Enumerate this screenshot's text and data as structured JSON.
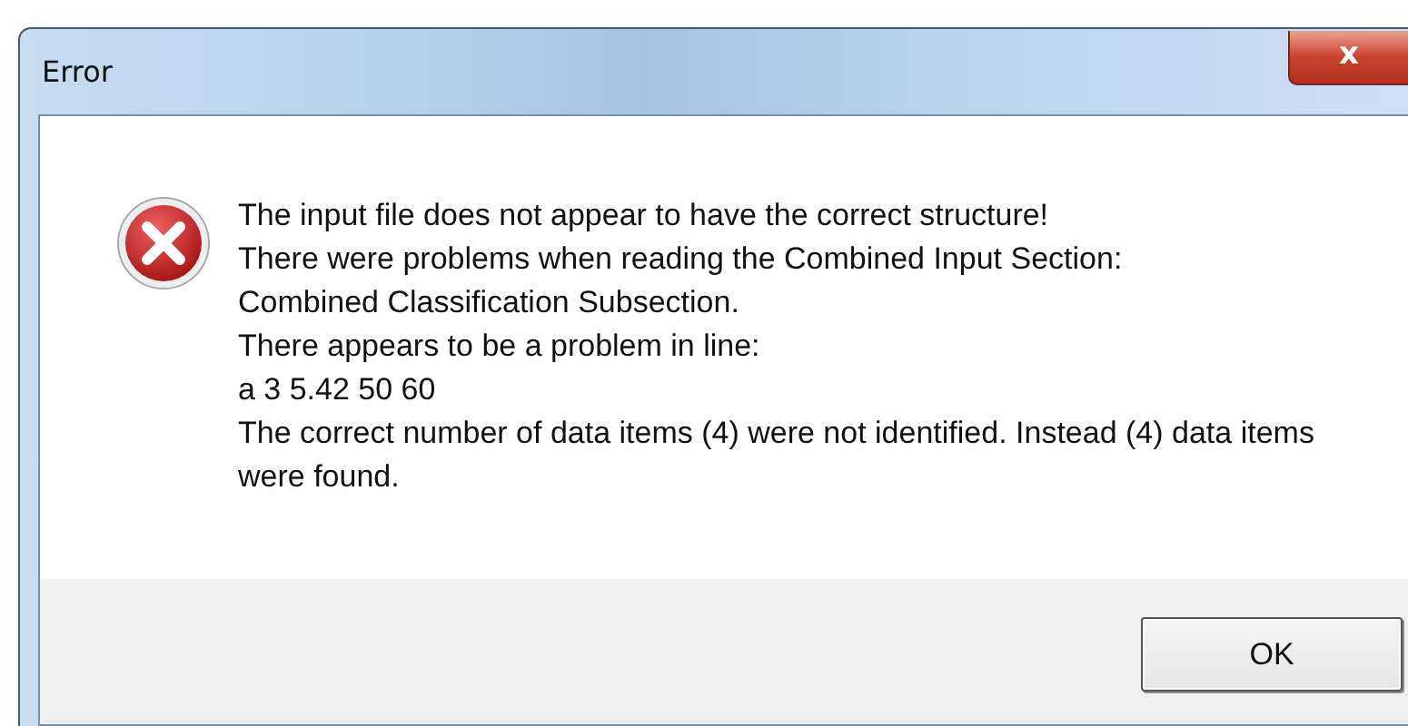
{
  "window": {
    "title": "Error",
    "close_label": "x"
  },
  "message": {
    "lines": [
      "The input file does not appear to have the correct structure!",
      "There were problems when reading the Combined Input Section:",
      "Combined Classification Subsection.",
      "There appears to be a problem in line:",
      "a 3 5.42 50 60",
      "The correct number of data items (4) were not identified. Instead (4) data items were found."
    ]
  },
  "buttons": [
    "OK"
  ]
}
